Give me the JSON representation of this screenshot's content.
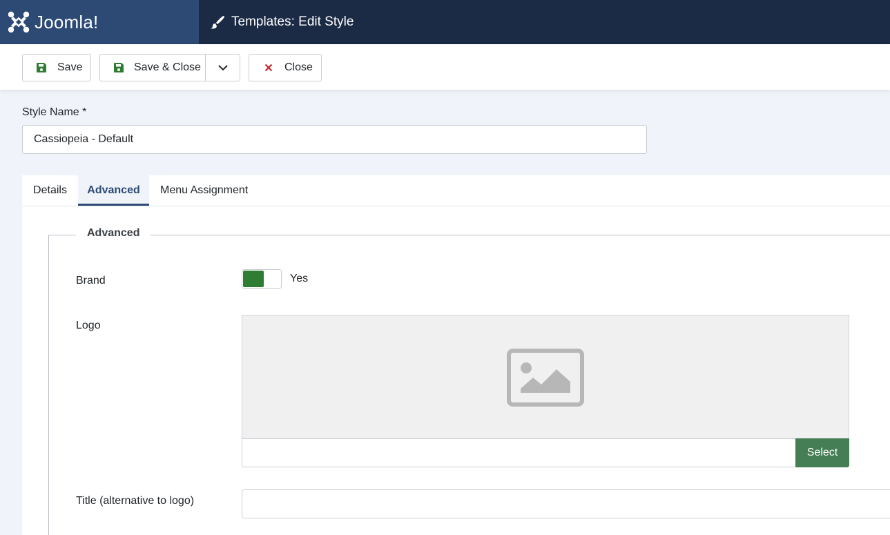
{
  "header": {
    "brand": "Joomla!",
    "page_title": "Templates: Edit Style",
    "colors": {
      "header_bg": "#1c2b45",
      "logo_bg": "#2c4a74"
    }
  },
  "toolbar": {
    "save_label": "Save",
    "save_close_label": "Save & Close",
    "close_label": "Close",
    "save_icon": "floppy-disk-icon",
    "dropdown_icon": "chevron-down-icon",
    "close_icon": "close-x-icon",
    "colors": {
      "save_icon": "#2f7d32",
      "close_icon": "#c52827"
    }
  },
  "form": {
    "style_name_label": "Style Name *",
    "style_name_value": "Cassiopeia - Default"
  },
  "tabs": [
    {
      "label": "Details",
      "active": false
    },
    {
      "label": "Advanced",
      "active": true
    },
    {
      "label": "Menu Assignment",
      "active": false
    }
  ],
  "advanced": {
    "legend": "Advanced",
    "brand": {
      "label": "Brand",
      "value": "Yes",
      "enabled": true
    },
    "logo": {
      "label": "Logo",
      "placeholder_icon": "image-placeholder-icon",
      "value": "",
      "select_label": "Select"
    },
    "title": {
      "label": "Title (alternative to logo)",
      "value": ""
    }
  }
}
